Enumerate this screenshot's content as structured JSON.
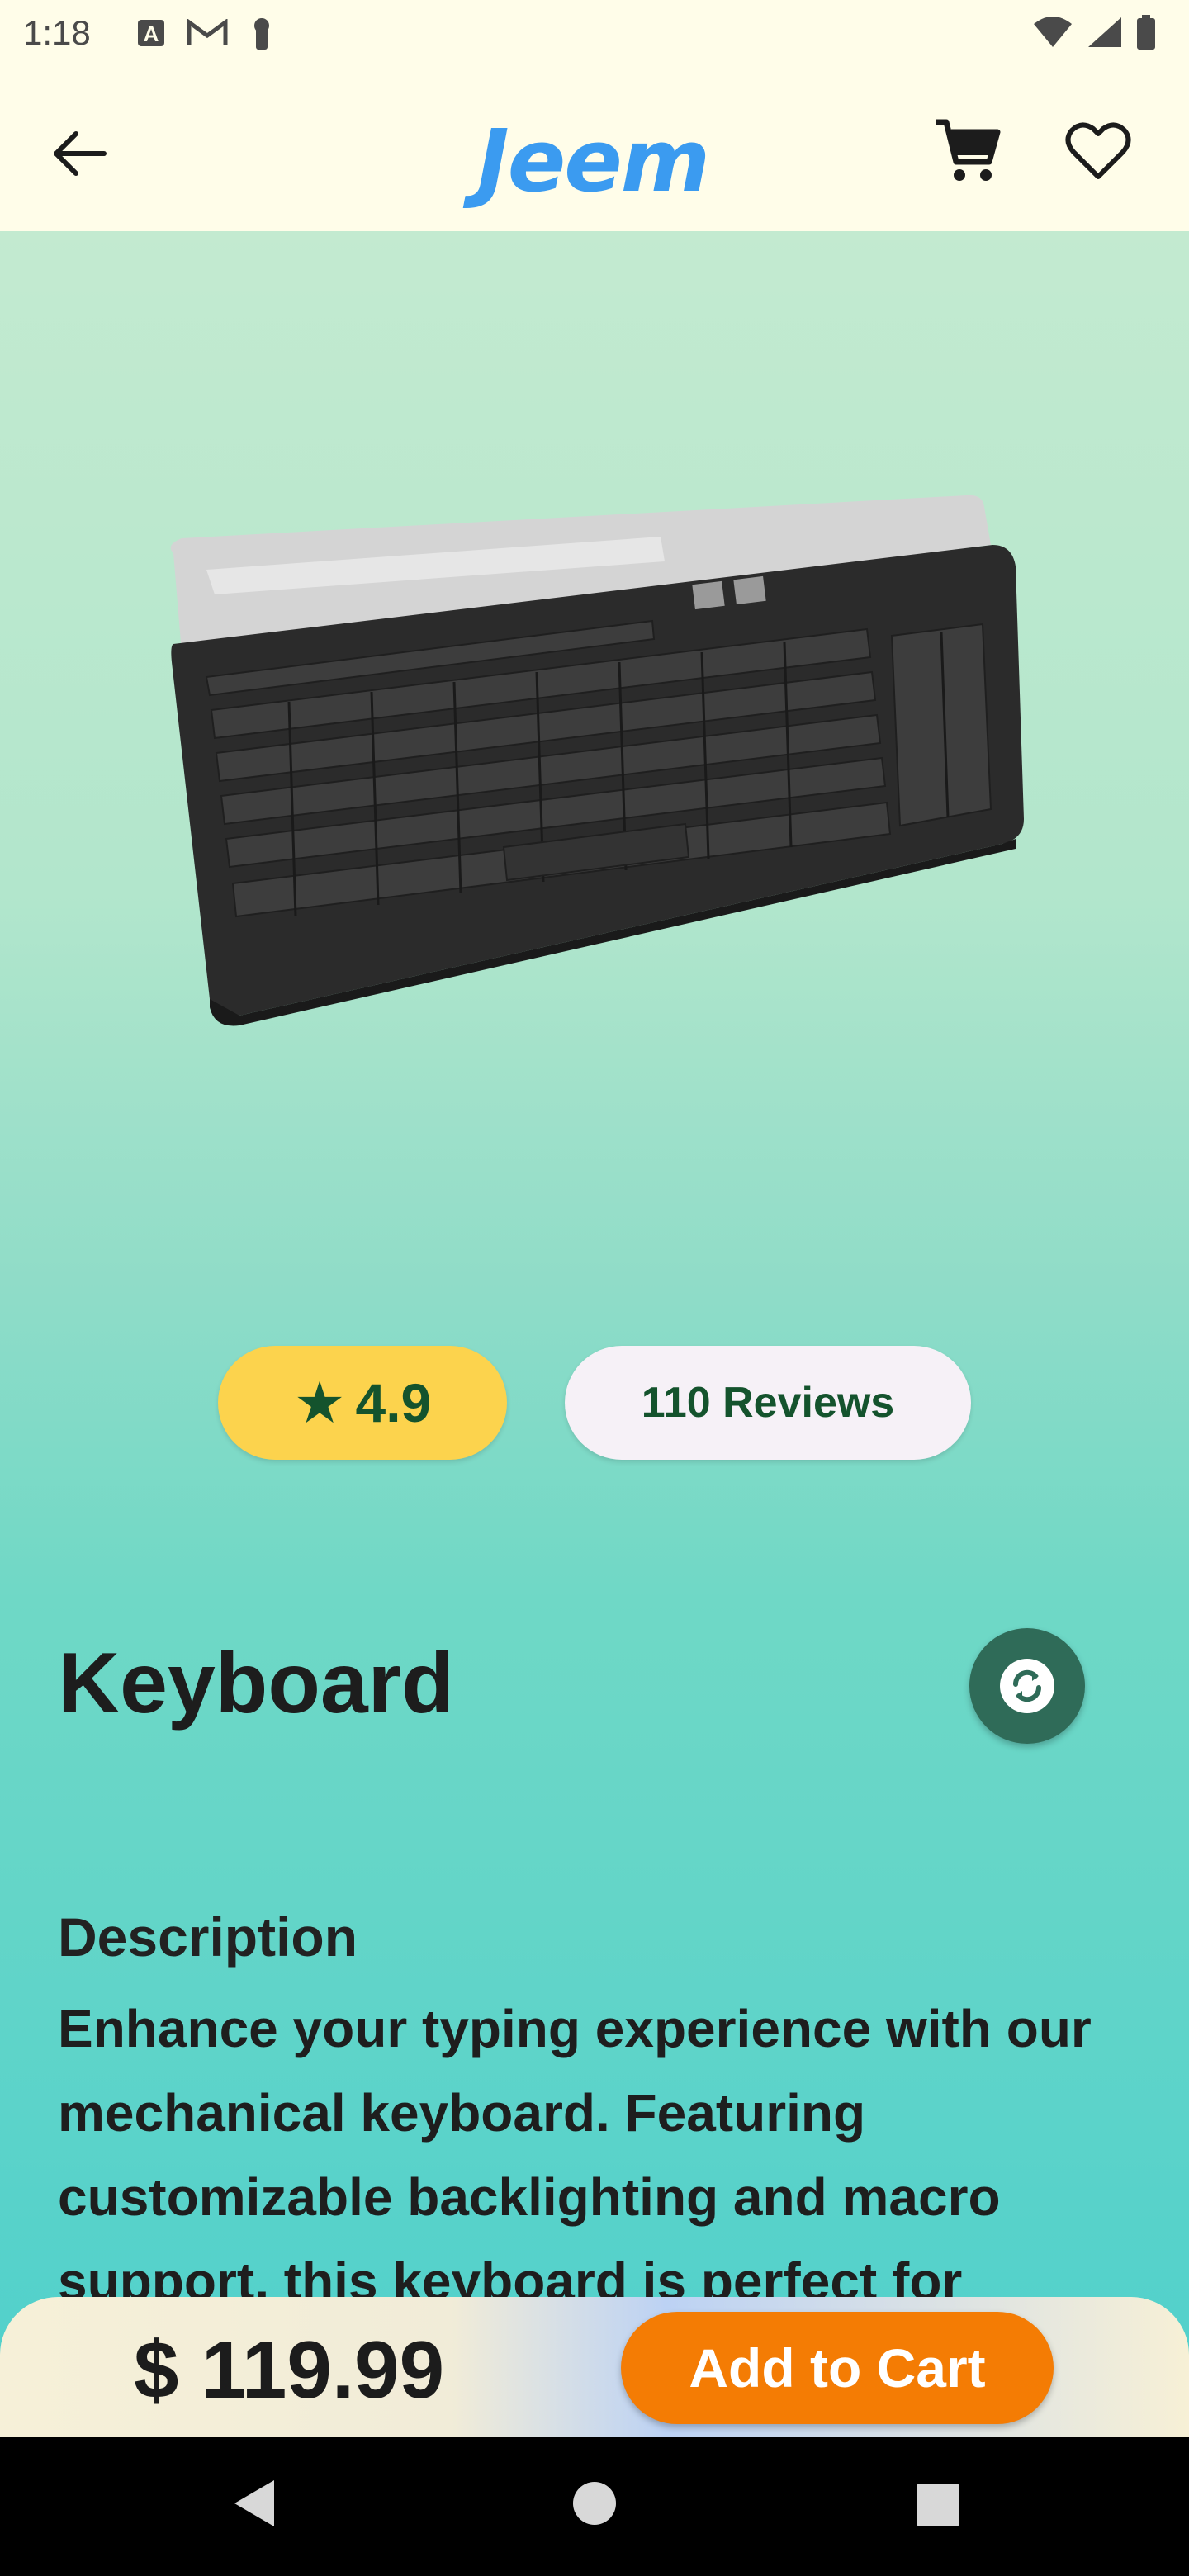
{
  "status_bar": {
    "time": "1:18",
    "icons": [
      "a-notification-icon",
      "gmail-icon",
      "lock-icon",
      "wifi-icon",
      "signal-icon",
      "battery-icon"
    ]
  },
  "app_bar": {
    "logo_text": "Jeem",
    "back_icon": "arrow-back-icon",
    "cart_icon": "shopping-cart-icon",
    "favorite_icon": "heart-outline-icon"
  },
  "product": {
    "image_subject": "keyboard",
    "rating": "4.9",
    "rating_star": "★",
    "reviews": "110 Reviews",
    "title": "Keyboard",
    "description_label": "Description",
    "description": "Enhance your typing experience with our mechanical keyboard. Featuring customizable backlighting and macro support, this keyboard is perfect for"
  },
  "purchase_bar": {
    "price": "$ 119.99",
    "add_to_cart": "Add to Cart"
  },
  "colors": {
    "accent_orange": "#f47c04",
    "rating_yellow": "#fcd34d",
    "rating_text_green": "#14532d",
    "logo_blue": "#3b9bf0",
    "compare_button_green": "#2f6b58"
  }
}
